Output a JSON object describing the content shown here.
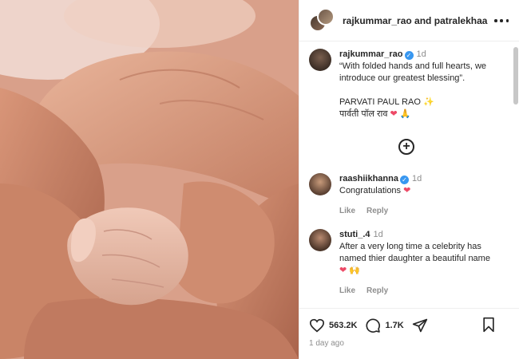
{
  "header": {
    "user1": "rajkummar_rao",
    "and": " and ",
    "user2": "patralekhaa"
  },
  "caption": {
    "username": "rajkummar_rao",
    "time": "1d",
    "line1": "“With folded hands and full hearts, we introduce our greatest blessing”.",
    "line2": "PARVATI PAUL RAO",
    "line3": "पार्वती पॉल राव"
  },
  "comments": [
    {
      "username": "raashiikhanna",
      "time": "1d",
      "text": "Congratulations",
      "like": "Like",
      "reply": "Reply"
    },
    {
      "username": "stuti_.4",
      "time": "1d",
      "text": "After a very long time a celebrity has named thier daughter a beautiful name",
      "like": "Like",
      "reply": "Reply"
    }
  ],
  "footer": {
    "likes": "563.2K",
    "comments": "1.7K",
    "date": "1 day ago"
  },
  "colors": {
    "heart": "#ed4966",
    "verified": "#3897f0",
    "muted": "#8e8e8e"
  },
  "icons": [
    "more-icon",
    "verified-badge-icon",
    "add-comment-icon",
    "heart-icon",
    "comment-icon",
    "share-icon",
    "bookmark-icon"
  ]
}
